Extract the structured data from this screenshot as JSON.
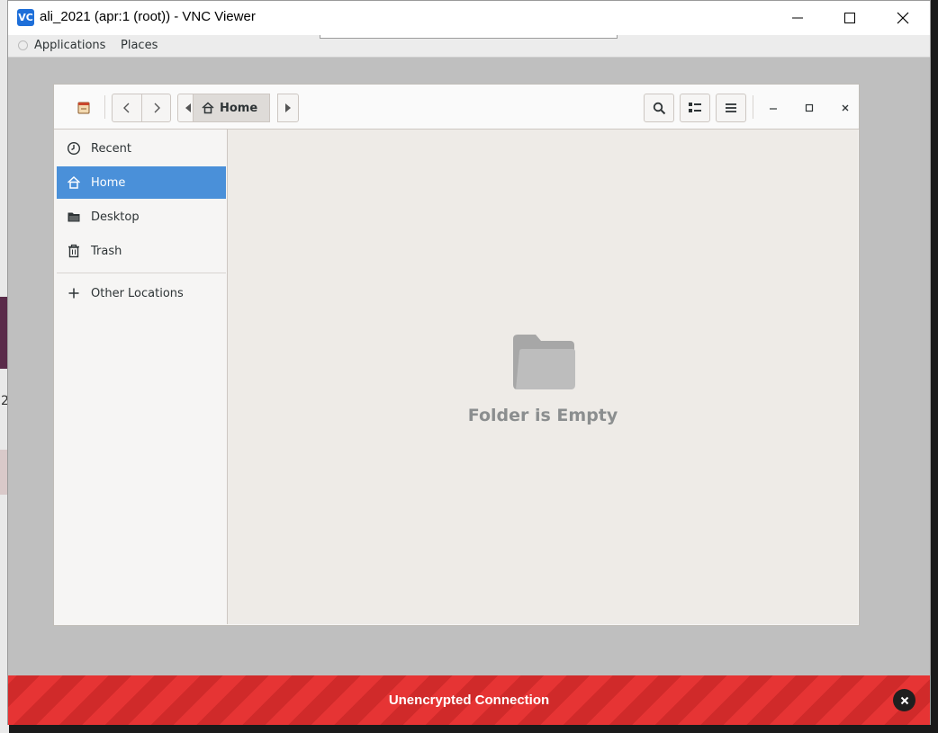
{
  "window": {
    "logo": "VC",
    "title": "ali_2021 (apr:1 (root)) - VNC Viewer"
  },
  "background": {
    "peek_number": "2"
  },
  "menubar": {
    "items": [
      {
        "label": "Applications"
      },
      {
        "label": "Places"
      }
    ]
  },
  "headerbar": {
    "path": "Home"
  },
  "sidebar": {
    "items": [
      {
        "label": "Recent",
        "icon": "clock-icon"
      },
      {
        "label": "Home",
        "icon": "home-icon",
        "selected": true
      },
      {
        "label": "Desktop",
        "icon": "folder-icon"
      },
      {
        "label": "Trash",
        "icon": "trash-icon"
      },
      {
        "label": "Other Locations",
        "icon": "plus-icon"
      }
    ]
  },
  "content": {
    "empty_label": "Folder is Empty",
    "icon": "folder-icon"
  },
  "banner": {
    "label": "Unencrypted Connection",
    "color": "#e63434"
  },
  "colors": {
    "selection": "#4a90d9",
    "vnc_brand": "#1e6fd9"
  }
}
